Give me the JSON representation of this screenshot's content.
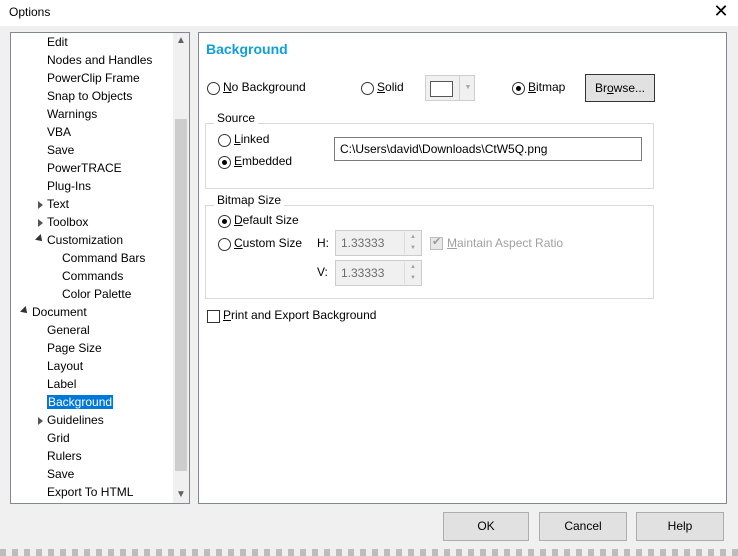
{
  "window": {
    "title": "Options",
    "close_glyph": "✕"
  },
  "tree": {
    "items": [
      {
        "label": "Edit"
      },
      {
        "label": "Nodes and Handles"
      },
      {
        "label": "PowerClip Frame"
      },
      {
        "label": "Snap to Objects"
      },
      {
        "label": "Warnings"
      },
      {
        "label": "VBA"
      },
      {
        "label": "Save"
      },
      {
        "label": "PowerTRACE"
      },
      {
        "label": "Plug-Ins"
      },
      {
        "label": "Text",
        "expander": "collapsed"
      },
      {
        "label": "Toolbox",
        "expander": "collapsed"
      },
      {
        "label": "Customization",
        "expander": "expanded"
      },
      {
        "label": "Command Bars"
      },
      {
        "label": "Commands"
      },
      {
        "label": "Color Palette"
      },
      {
        "label": "Document",
        "expander": "expanded"
      },
      {
        "label": "General"
      },
      {
        "label": "Page Size"
      },
      {
        "label": "Layout"
      },
      {
        "label": "Label"
      },
      {
        "label": "Background",
        "selected": true
      },
      {
        "label": "Guidelines",
        "expander": "collapsed"
      },
      {
        "label": "Grid"
      },
      {
        "label": "Rulers"
      },
      {
        "label": "Save"
      },
      {
        "label": "Export To HTML"
      }
    ],
    "scroll_up_glyph": "▲",
    "scroll_down_glyph": "▼"
  },
  "panel": {
    "heading": "Background",
    "background_mode": {
      "no_background": {
        "pre": "",
        "ul": "N",
        "post": "o Background",
        "checked": false
      },
      "solid": {
        "pre": "",
        "ul": "S",
        "post": "olid",
        "checked": false
      },
      "bitmap": {
        "pre": "",
        "ul": "B",
        "post": "itmap",
        "checked": true
      },
      "solid_color": "#ffffff",
      "dropdown_glyph": "▼"
    },
    "browse_button": {
      "pre": "Br",
      "ul": "o",
      "post": "wse..."
    },
    "source": {
      "title": "Source",
      "linked": {
        "pre": "",
        "ul": "L",
        "post": "inked",
        "checked": false
      },
      "embedded": {
        "pre": "",
        "ul": "E",
        "post": "mbedded",
        "checked": true
      },
      "path": "C:\\Users\\david\\Downloads\\CtW5Q.png"
    },
    "bitmap_size": {
      "title": "Bitmap Size",
      "default_size": {
        "pre": "",
        "ul": "D",
        "post": "efault Size",
        "checked": true
      },
      "custom_size": {
        "pre": "",
        "ul": "C",
        "post": "ustom Size",
        "checked": false
      },
      "h_label": "H:",
      "v_label": "V:",
      "h_value": "1.33333",
      "v_value": "1.33333",
      "spin_up_glyph": "▲",
      "spin_down_glyph": "▼",
      "maintain_aspect": {
        "pre": "",
        "ul": "M",
        "post": "aintain Aspect Ratio",
        "checked": true,
        "enabled": false
      }
    },
    "print_export": {
      "pre": "",
      "ul": "P",
      "post": "rint and Export Background",
      "checked": false
    }
  },
  "footer": {
    "ok": "OK",
    "cancel": "Cancel",
    "help": "Help"
  },
  "colors": {
    "heading": "#0fa0d9",
    "selection": "#0078d7"
  }
}
